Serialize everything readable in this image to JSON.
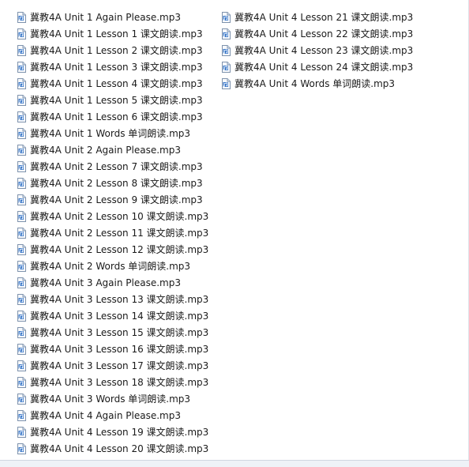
{
  "file_icon": "audio-file-icon",
  "columns": [
    [
      "冀教4A Unit 1 Again Please.mp3",
      "冀教4A Unit 1 Lesson 1 课文朗读.mp3",
      "冀教4A Unit 1 Lesson 2 课文朗读.mp3",
      "冀教4A Unit 1 Lesson 3 课文朗读.mp3",
      "冀教4A Unit 1 Lesson 4 课文朗读.mp3",
      "冀教4A Unit 1 Lesson 5 课文朗读.mp3",
      "冀教4A Unit 1 Lesson 6 课文朗读.mp3",
      "冀教4A Unit 1 Words 单词朗读.mp3",
      "冀教4A Unit 2 Again Please.mp3",
      "冀教4A Unit 2 Lesson 7 课文朗读.mp3",
      "冀教4A Unit 2 Lesson 8 课文朗读.mp3",
      "冀教4A Unit 2 Lesson 9 课文朗读.mp3",
      "冀教4A Unit 2 Lesson 10 课文朗读.mp3",
      "冀教4A Unit 2 Lesson 11 课文朗读.mp3",
      "冀教4A Unit 2 Lesson 12 课文朗读.mp3",
      "冀教4A Unit 2 Words 单词朗读.mp3",
      "冀教4A Unit 3 Again Please.mp3",
      "冀教4A Unit 3 Lesson 13 课文朗读.mp3",
      "冀教4A Unit 3 Lesson 14 课文朗读.mp3",
      "冀教4A Unit 3 Lesson 15 课文朗读.mp3",
      "冀教4A Unit 3 Lesson 16 课文朗读.mp3",
      "冀教4A Unit 3 Lesson 17 课文朗读.mp3",
      "冀教4A Unit 3 Lesson 18 课文朗读.mp3",
      "冀教4A Unit 3 Words 单词朗读.mp3",
      "冀教4A Unit 4 Again Please.mp3",
      "冀教4A Unit 4 Lesson 19 课文朗读.mp3",
      "冀教4A Unit 4 Lesson 20 课文朗读.mp3"
    ],
    [
      "冀教4A Unit 4 Lesson 21 课文朗读.mp3",
      "冀教4A Unit 4 Lesson 22 课文朗读.mp3",
      "冀教4A Unit 4 Lesson 23 课文朗读.mp3",
      "冀教4A Unit 4 Lesson 24 课文朗读.mp3",
      "冀教4A Unit 4 Words 单词朗读.mp3"
    ]
  ]
}
